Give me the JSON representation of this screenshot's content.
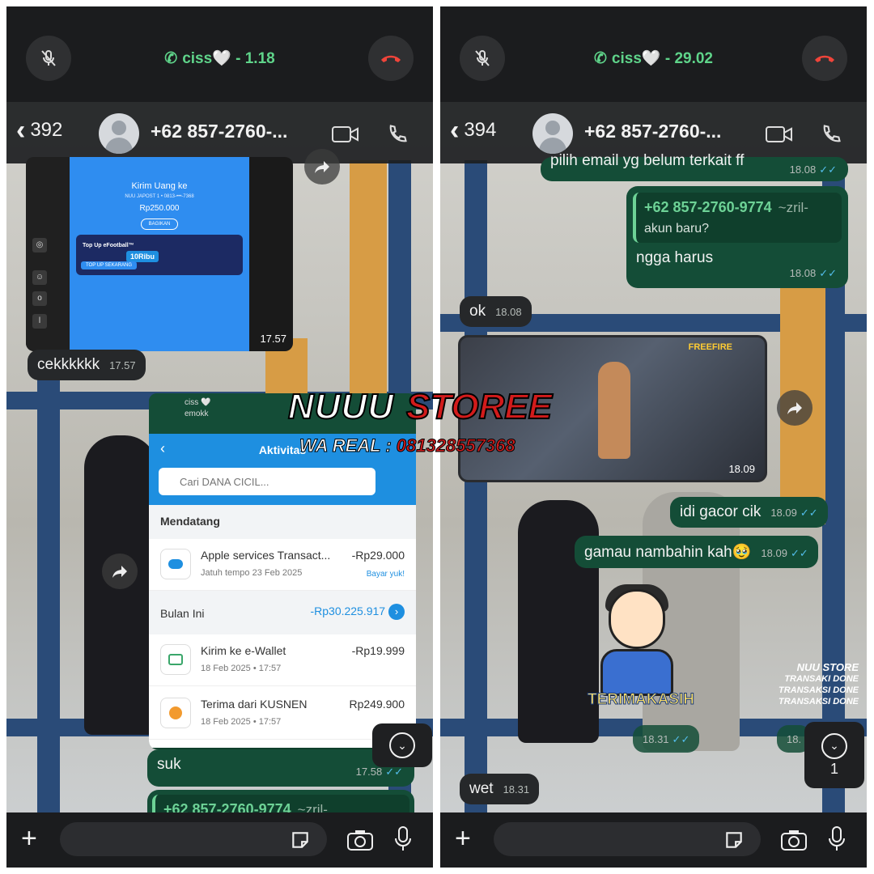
{
  "left": {
    "call": {
      "name": "ciss🤍",
      "duration": "1.18"
    },
    "header": {
      "unread": "392",
      "contact": "+62 857-2760-..."
    },
    "media_dana": {
      "title": "Kirim Uang ke",
      "subtitle": "NUU JAPOST 1 • 0813-•••-7368",
      "amount": "Rp250.000",
      "share": "BAGIKAN",
      "promo_top": "Top Up eFootball™",
      "promo_badge": "10Ribu",
      "promo_btn": "TOP UP SEKARANG",
      "time": "17.57"
    },
    "msg1": {
      "text": "cekkkkkk",
      "time": "17.57"
    },
    "dana_app": {
      "chat_name": "ciss 🤍",
      "chat_sub": "emokk",
      "title": "Aktivitas",
      "search_placeholder": "Cari DANA CICIL...",
      "section1": "Mendatang",
      "row1": {
        "title": "Apple services Transact...",
        "sub": "Jatuh tempo 23 Feb 2025",
        "amount": "-Rp29.000",
        "action": "Bayar yuk!"
      },
      "section2": "Bulan Ini",
      "section2_total": "-Rp30.225.917",
      "row2": {
        "title": "Kirim ke e-Wallet",
        "sub": "18 Feb 2025 • 17:57",
        "amount": "-Rp19.999"
      },
      "row3": {
        "title": "Terima dari KUSNEN",
        "sub": "18 Feb 2025 • 17:57",
        "amount": "Rp249.900"
      }
    },
    "msg2": {
      "text": "suk",
      "time": "17.58"
    },
    "msg3_quote": {
      "number": "+62 857-2760-9774",
      "name": "~zril-"
    },
    "input_placeholder": ""
  },
  "right": {
    "call": {
      "name": "ciss🤍",
      "duration": "29.02"
    },
    "header": {
      "unread": "394",
      "contact": "+62 857-2760-..."
    },
    "msg_top": {
      "text": "pilih email yg belum terkait ff",
      "time": "18.08"
    },
    "msg_reply": {
      "quote_number": "+62 857-2760-9774",
      "quote_name": "~zril-",
      "quote_text": "akun  baru?",
      "text": "ngga harus",
      "time": "18.08"
    },
    "msg_ok": {
      "text": "ok",
      "time": "18.08"
    },
    "game": {
      "logo": "FREEFIRE",
      "time": "18.09"
    },
    "msg_gacor": {
      "text": "idi gacor cik",
      "time": "18.09"
    },
    "msg_nambah": {
      "text": "gamau nambahin kah🥹",
      "time": "18.09"
    },
    "sticker_label": "TERIMAKASIH",
    "sticker_time": "18.31",
    "sticker2_time": "18.",
    "trx_lines": [
      "NUU STORE",
      "TRANSAKI DONE",
      "TRANSAKSI DONE",
      "TRANSAKSI DONE"
    ],
    "msg_wet": {
      "text": "wet",
      "time": "18.31"
    },
    "unread_count": "1"
  },
  "watermark": {
    "brand1": "NUUU",
    "brand2": "STOREE",
    "contact_label": "WA REAL : ",
    "contact_number": "081328557368"
  },
  "colors": {
    "call_green": "#5fd48a",
    "outgoing": "#144d37",
    "incoming": "#26282a",
    "ticks": "#53bdeb",
    "wall_blue": "#2a4b78"
  }
}
